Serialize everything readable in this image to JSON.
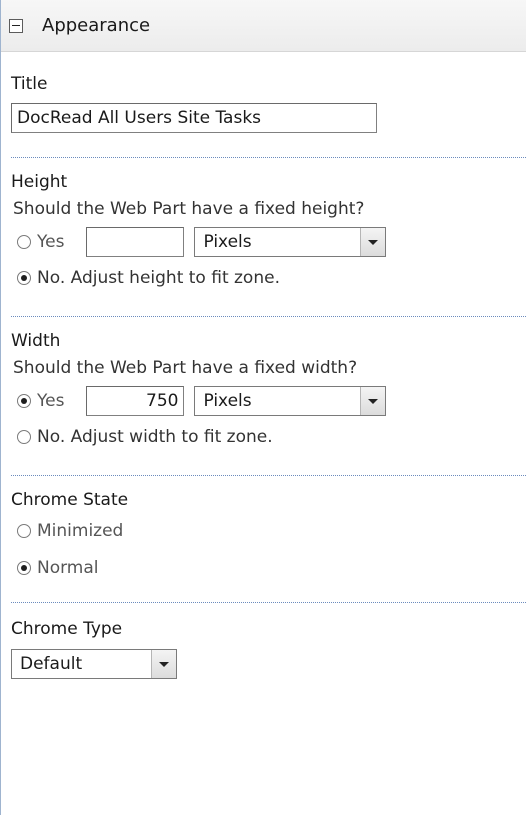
{
  "section": {
    "title": "Appearance"
  },
  "title_field": {
    "label": "Title",
    "value": "DocRead All Users Site Tasks"
  },
  "height": {
    "label": "Height",
    "question": "Should the Web Part have a fixed height?",
    "yes_label": "Yes",
    "value": "",
    "unit": "Pixels",
    "no_label": "No. Adjust height to fit zone.",
    "selected": "no"
  },
  "width": {
    "label": "Width",
    "question": "Should the Web Part have a fixed width?",
    "yes_label": "Yes",
    "value": "750",
    "unit": "Pixels",
    "no_label": "No. Adjust width to fit zone.",
    "selected": "yes"
  },
  "chrome_state": {
    "label": "Chrome State",
    "options": [
      "Minimized",
      "Normal"
    ],
    "selected": "Normal"
  },
  "chrome_type": {
    "label": "Chrome Type",
    "value": "Default"
  }
}
